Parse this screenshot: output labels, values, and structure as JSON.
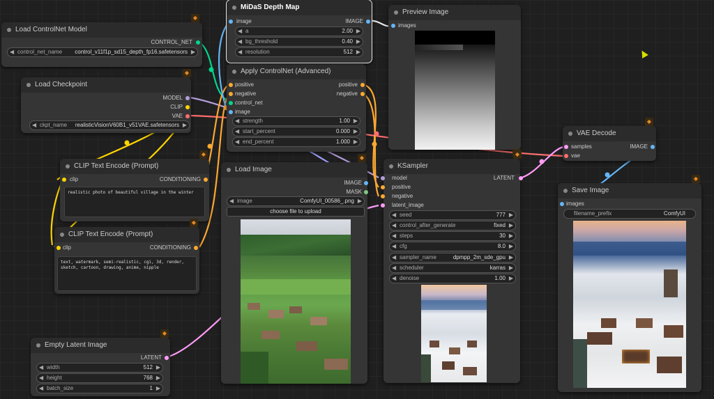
{
  "colors": {
    "model": "#b39ddb",
    "clip": "#ffd500",
    "vae": "#ff6e6e",
    "conditioning": "#ffa931",
    "latent": "#ff9cf9",
    "image": "#64b5f6",
    "control_net": "#00d78d",
    "mask": "#81c784"
  },
  "icons": {
    "badge": "fox-badge-icon",
    "arrow_left": "◀",
    "arrow_right": "▶"
  },
  "load_controlnet": {
    "title": "Load ControlNet Model",
    "out_control_net": "CONTROL_NET",
    "w_label": "control_net_name",
    "w_value": "control_v11f1p_sd15_depth_fp16.safetensors"
  },
  "load_checkpoint": {
    "title": "Load Checkpoint",
    "out_model": "MODEL",
    "out_clip": "CLIP",
    "out_vae": "VAE",
    "w_label": "ckpt_name",
    "w_value": "realisticVisionV60B1_v51VAE.safetensors"
  },
  "clip_pos": {
    "title": "CLIP Text Encode (Prompt)",
    "in_clip": "clip",
    "out_cond": "CONDITIONING",
    "text": "realistic photo of beautiful village in the winter"
  },
  "clip_neg": {
    "title": "CLIP Text Encode (Prompt)",
    "in_clip": "clip",
    "out_cond": "CONDITIONING",
    "text": "text, watermark, semi-realistic, cgi, 3d, render, sketch, cartoon, drawing, anime, nipple"
  },
  "empty_latent": {
    "title": "Empty Latent Image",
    "out_latent": "LATENT",
    "width_label": "width",
    "width": "512",
    "height_label": "height",
    "height": "768",
    "batch_label": "batch_size",
    "batch": "1"
  },
  "midas": {
    "title": "MiDaS Depth Map",
    "in_image": "image",
    "out_image": "IMAGE",
    "a_label": "a",
    "a": "2.00",
    "bg_label": "bg_threshold",
    "bg": "0.40",
    "res_label": "resolution",
    "res": "512"
  },
  "apply_cn": {
    "title": "Apply ControlNet (Advanced)",
    "in_pos": "positive",
    "in_neg": "negative",
    "in_cn": "control_net",
    "in_image": "image",
    "out_pos": "positive",
    "out_neg": "negative",
    "strength_label": "strength",
    "strength": "1.00",
    "start_label": "start_percent",
    "start": "0.000",
    "end_label": "end_percent",
    "end": "1.000"
  },
  "preview": {
    "title": "Preview Image",
    "in_images": "images"
  },
  "load_image": {
    "title": "Load Image",
    "out_image": "IMAGE",
    "out_mask": "MASK",
    "w_label": "image",
    "w_value": "ComfyUI_00586_.png",
    "upload": "choose file to upload"
  },
  "ksampler": {
    "title": "KSampler",
    "in_model": "model",
    "in_pos": "positive",
    "in_neg": "negative",
    "in_latent": "latent_image",
    "out_latent": "LATENT",
    "widgets": [
      {
        "label": "seed",
        "value": "777"
      },
      {
        "label": "control_after_generate",
        "value": "fixed"
      },
      {
        "label": "steps",
        "value": "30"
      },
      {
        "label": "cfg",
        "value": "8.0"
      },
      {
        "label": "sampler_name",
        "value": "dpmpp_2m_sde_gpu"
      },
      {
        "label": "scheduler",
        "value": "karras"
      },
      {
        "label": "denoise",
        "value": "1.00"
      }
    ]
  },
  "vae_decode": {
    "title": "VAE Decode",
    "in_samples": "samples",
    "in_vae": "vae",
    "out_image": "IMAGE"
  },
  "save_image": {
    "title": "Save Image",
    "in_images": "images",
    "w_label": "filename_prefix",
    "w_value": "ComfyUI"
  }
}
